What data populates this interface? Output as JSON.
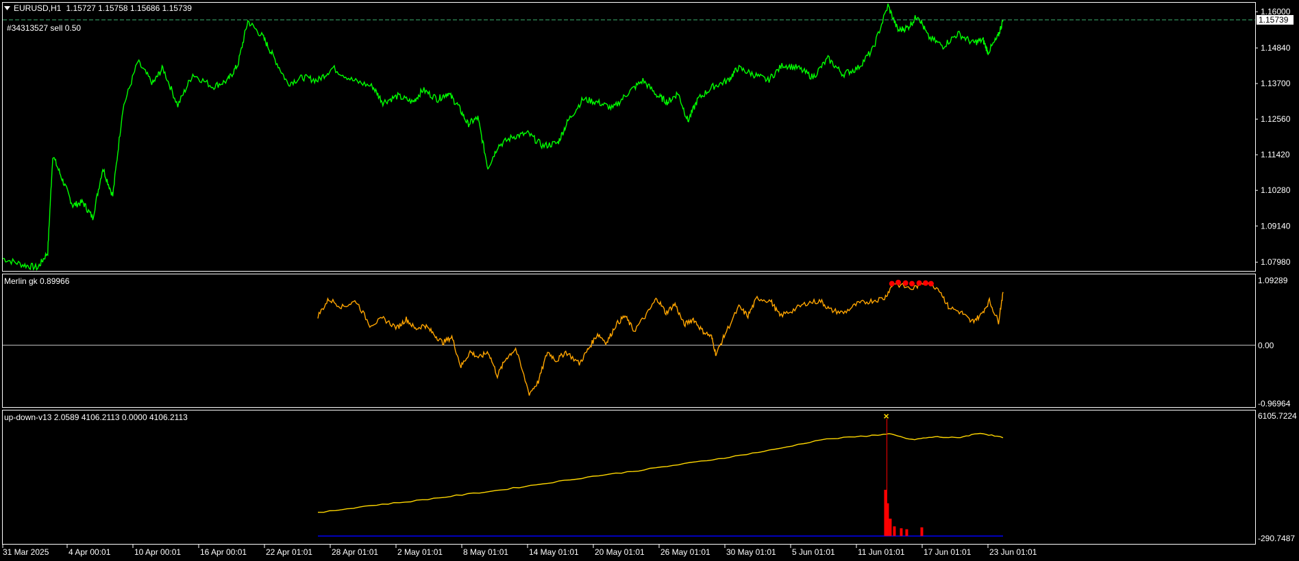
{
  "header": {
    "symbol_tf": "EURUSD,H1",
    "ohlc": "1.15727 1.15758 1.15686 1.15739"
  },
  "order_label": "#34313527 sell 0.50",
  "colors": {
    "price": "#00ff00",
    "merlin": "#ffa500",
    "updown": "#ffd700",
    "spike": "#ff0000",
    "base": "#0000ff",
    "grid": "#ffffff"
  },
  "chart_data": [
    {
      "type": "line",
      "name": "EURUSD,H1",
      "series": [
        {
          "name": "EURUSD,H1",
          "color": "#00ff00"
        }
      ],
      "x_labels": [
        "31 Mar 2025",
        "4 Apr 00:01",
        "10 Apr 00:01",
        "16 Apr 00:01",
        "22 Apr 01:01",
        "28 Apr 01:01",
        "2 May 01:01",
        "8 May 01:01",
        "14 May 01:01",
        "20 May 01:01",
        "26 May 01:01",
        "30 May 01:01",
        "5 Jun 01:01",
        "11 Jun 01:01",
        "17 Jun 01:01",
        "23 Jun 01:01"
      ],
      "y_ticks": [
        "1.16000",
        "1.14840",
        "1.13700",
        "1.12560",
        "1.11420",
        "1.10280",
        "1.09140",
        "1.07980"
      ],
      "ylim": [
        1.077,
        1.162
      ],
      "current_price": "1.15739",
      "order_line": 1.1574,
      "path": [
        [
          0,
          1.081
        ],
        [
          0.02,
          1.079
        ],
        [
          0.035,
          1.078
        ],
        [
          0.045,
          1.083
        ],
        [
          0.05,
          1.114
        ],
        [
          0.06,
          1.106
        ],
        [
          0.07,
          1.098
        ],
        [
          0.08,
          1.099
        ],
        [
          0.09,
          1.094
        ],
        [
          0.1,
          1.11
        ],
        [
          0.11,
          1.101
        ],
        [
          0.12,
          1.129
        ],
        [
          0.135,
          1.144
        ],
        [
          0.15,
          1.137
        ],
        [
          0.16,
          1.142
        ],
        [
          0.175,
          1.13
        ],
        [
          0.19,
          1.14
        ],
        [
          0.21,
          1.136
        ],
        [
          0.225,
          1.138
        ],
        [
          0.235,
          1.143
        ],
        [
          0.245,
          1.157
        ],
        [
          0.26,
          1.152
        ],
        [
          0.27,
          1.146
        ],
        [
          0.285,
          1.137
        ],
        [
          0.3,
          1.139
        ],
        [
          0.315,
          1.138
        ],
        [
          0.33,
          1.142
        ],
        [
          0.35,
          1.138
        ],
        [
          0.37,
          1.136
        ],
        [
          0.38,
          1.131
        ],
        [
          0.395,
          1.133
        ],
        [
          0.41,
          1.131
        ],
        [
          0.42,
          1.135
        ],
        [
          0.435,
          1.132
        ],
        [
          0.445,
          1.134
        ],
        [
          0.455,
          1.13
        ],
        [
          0.465,
          1.124
        ],
        [
          0.475,
          1.126
        ],
        [
          0.485,
          1.11
        ],
        [
          0.495,
          1.117
        ],
        [
          0.51,
          1.12
        ],
        [
          0.525,
          1.121
        ],
        [
          0.54,
          1.117
        ],
        [
          0.555,
          1.118
        ],
        [
          0.565,
          1.125
        ],
        [
          0.58,
          1.132
        ],
        [
          0.595,
          1.131
        ],
        [
          0.61,
          1.129
        ],
        [
          0.625,
          1.134
        ],
        [
          0.64,
          1.138
        ],
        [
          0.655,
          1.133
        ],
        [
          0.665,
          1.131
        ],
        [
          0.675,
          1.134
        ],
        [
          0.685,
          1.125
        ],
        [
          0.695,
          1.132
        ],
        [
          0.71,
          1.136
        ],
        [
          0.725,
          1.138
        ],
        [
          0.735,
          1.142
        ],
        [
          0.75,
          1.14
        ],
        [
          0.765,
          1.138
        ],
        [
          0.78,
          1.143
        ],
        [
          0.795,
          1.142
        ],
        [
          0.81,
          1.139
        ],
        [
          0.825,
          1.145
        ],
        [
          0.84,
          1.14
        ],
        [
          0.855,
          1.142
        ],
        [
          0.87,
          1.148
        ],
        [
          0.885,
          1.162
        ],
        [
          0.895,
          1.154
        ],
        [
          0.905,
          1.155
        ],
        [
          0.915,
          1.159
        ],
        [
          0.925,
          1.152
        ],
        [
          0.94,
          1.149
        ],
        [
          0.955,
          1.153
        ],
        [
          0.97,
          1.15
        ],
        [
          0.98,
          1.151
        ],
        [
          0.985,
          1.147
        ],
        [
          0.995,
          1.152
        ],
        [
          1,
          1.1574
        ]
      ]
    },
    {
      "type": "line",
      "name": "Merlin gk",
      "title": "Merlin gk 0.89966",
      "series": [
        {
          "name": "Merlin gk",
          "color": "#ffa500"
        }
      ],
      "y_ticks": [
        "1.09289",
        "0.00",
        "-0.96964"
      ],
      "ylim": [
        -0.96964,
        1.09289
      ],
      "path": [
        [
          0.248,
          0.5
        ],
        [
          0.26,
          0.78
        ],
        [
          0.275,
          0.65
        ],
        [
          0.29,
          0.75
        ],
        [
          0.305,
          0.35
        ],
        [
          0.32,
          0.45
        ],
        [
          0.335,
          0.3
        ],
        [
          0.345,
          0.45
        ],
        [
          0.355,
          0.28
        ],
        [
          0.365,
          0.35
        ],
        [
          0.375,
          0.2
        ],
        [
          0.385,
          0.05
        ],
        [
          0.395,
          0.15
        ],
        [
          0.405,
          -0.35
        ],
        [
          0.415,
          -0.1
        ],
        [
          0.425,
          -0.2
        ],
        [
          0.435,
          -0.1
        ],
        [
          0.445,
          -0.5
        ],
        [
          0.455,
          -0.2
        ],
        [
          0.465,
          -0.05
        ],
        [
          0.48,
          -0.8
        ],
        [
          0.49,
          -0.6
        ],
        [
          0.5,
          -0.1
        ],
        [
          0.51,
          -0.25
        ],
        [
          0.52,
          -0.1
        ],
        [
          0.535,
          -0.3
        ],
        [
          0.545,
          -0.05
        ],
        [
          0.555,
          0.2
        ],
        [
          0.565,
          0.05
        ],
        [
          0.575,
          0.35
        ],
        [
          0.585,
          0.5
        ],
        [
          0.595,
          0.25
        ],
        [
          0.61,
          0.55
        ],
        [
          0.62,
          0.8
        ],
        [
          0.63,
          0.55
        ],
        [
          0.64,
          0.7
        ],
        [
          0.65,
          0.35
        ],
        [
          0.66,
          0.45
        ],
        [
          0.67,
          0.25
        ],
        [
          0.68,
          0.15
        ],
        [
          0.685,
          -0.15
        ],
        [
          0.695,
          0.2
        ],
        [
          0.71,
          0.65
        ],
        [
          0.72,
          0.5
        ],
        [
          0.73,
          0.8
        ],
        [
          0.745,
          0.75
        ],
        [
          0.755,
          0.5
        ],
        [
          0.77,
          0.6
        ],
        [
          0.785,
          0.72
        ],
        [
          0.8,
          0.75
        ],
        [
          0.81,
          0.6
        ],
        [
          0.825,
          0.55
        ],
        [
          0.84,
          0.7
        ],
        [
          0.855,
          0.75
        ],
        [
          0.87,
          0.8
        ],
        [
          0.88,
          1.05
        ],
        [
          0.9,
          0.95
        ],
        [
          0.915,
          1.08
        ],
        [
          0.93,
          0.95
        ],
        [
          0.94,
          0.65
        ],
        [
          0.955,
          0.55
        ],
        [
          0.965,
          0.4
        ],
        [
          0.975,
          0.5
        ],
        [
          0.985,
          0.75
        ],
        [
          0.995,
          0.4
        ],
        [
          1,
          0.9
        ]
      ],
      "dots": [
        [
          0.878,
          1.04
        ],
        [
          0.885,
          1.06
        ],
        [
          0.893,
          1.05
        ],
        [
          0.9,
          1.04
        ],
        [
          0.908,
          1.05
        ],
        [
          0.915,
          1.05
        ],
        [
          0.921,
          1.04
        ]
      ]
    },
    {
      "type": "line",
      "name": "up-down-v13",
      "title": "up-down-v13 2.0589 4106.2113 0.0000 4106.2113",
      "series": [
        {
          "name": "up-down-v13",
          "color": "#ffd700"
        }
      ],
      "y_ticks": [
        "6105.7224",
        "-290.7487"
      ],
      "ylim": [
        -290.7487,
        6105.7224
      ],
      "path": [
        [
          0.248,
          1000
        ],
        [
          0.3,
          1350
        ],
        [
          0.35,
          1600
        ],
        [
          0.4,
          1900
        ],
        [
          0.45,
          2200
        ],
        [
          0.5,
          2550
        ],
        [
          0.55,
          2900
        ],
        [
          0.6,
          3200
        ],
        [
          0.65,
          3550
        ],
        [
          0.7,
          3900
        ],
        [
          0.75,
          4300
        ],
        [
          0.8,
          4800
        ],
        [
          0.85,
          5000
        ],
        [
          0.875,
          5100
        ],
        [
          0.9,
          4800
        ],
        [
          0.925,
          4950
        ],
        [
          0.95,
          4900
        ],
        [
          0.975,
          5150
        ],
        [
          1,
          4900
        ]
      ],
      "spike": [
        [
          0.872,
          -290
        ],
        [
          0.872,
          6000
        ],
        [
          0.874,
          -290
        ]
      ],
      "spike_bar": [
        [
          0.869,
          2000
        ],
        [
          0.872,
          2000
        ],
        [
          0.879,
          600
        ],
        [
          0.885,
          -200
        ],
        [
          0.895,
          -100
        ],
        [
          0.905,
          -200
        ]
      ],
      "x_marker": 0.8725
    }
  ]
}
